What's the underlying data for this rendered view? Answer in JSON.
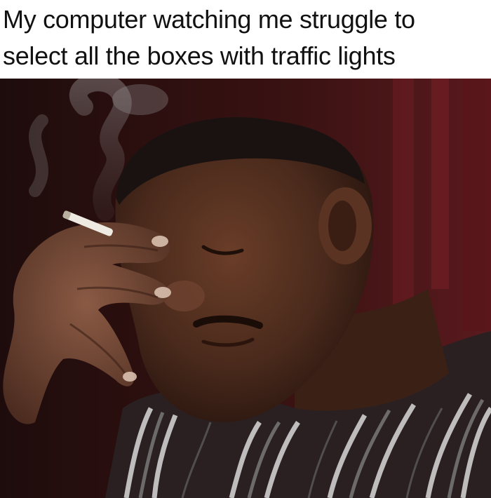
{
  "meme": {
    "caption_lines": [
      "My computer watching me struggle to",
      "select all the boxes with traffic lights"
    ]
  },
  "colors": {
    "caption_background": "#ffffff",
    "caption_text": "#111111",
    "backdrop": "#3a1414",
    "skin": "#4a2a1c",
    "shirt_stripes": "#d8d8d8"
  }
}
